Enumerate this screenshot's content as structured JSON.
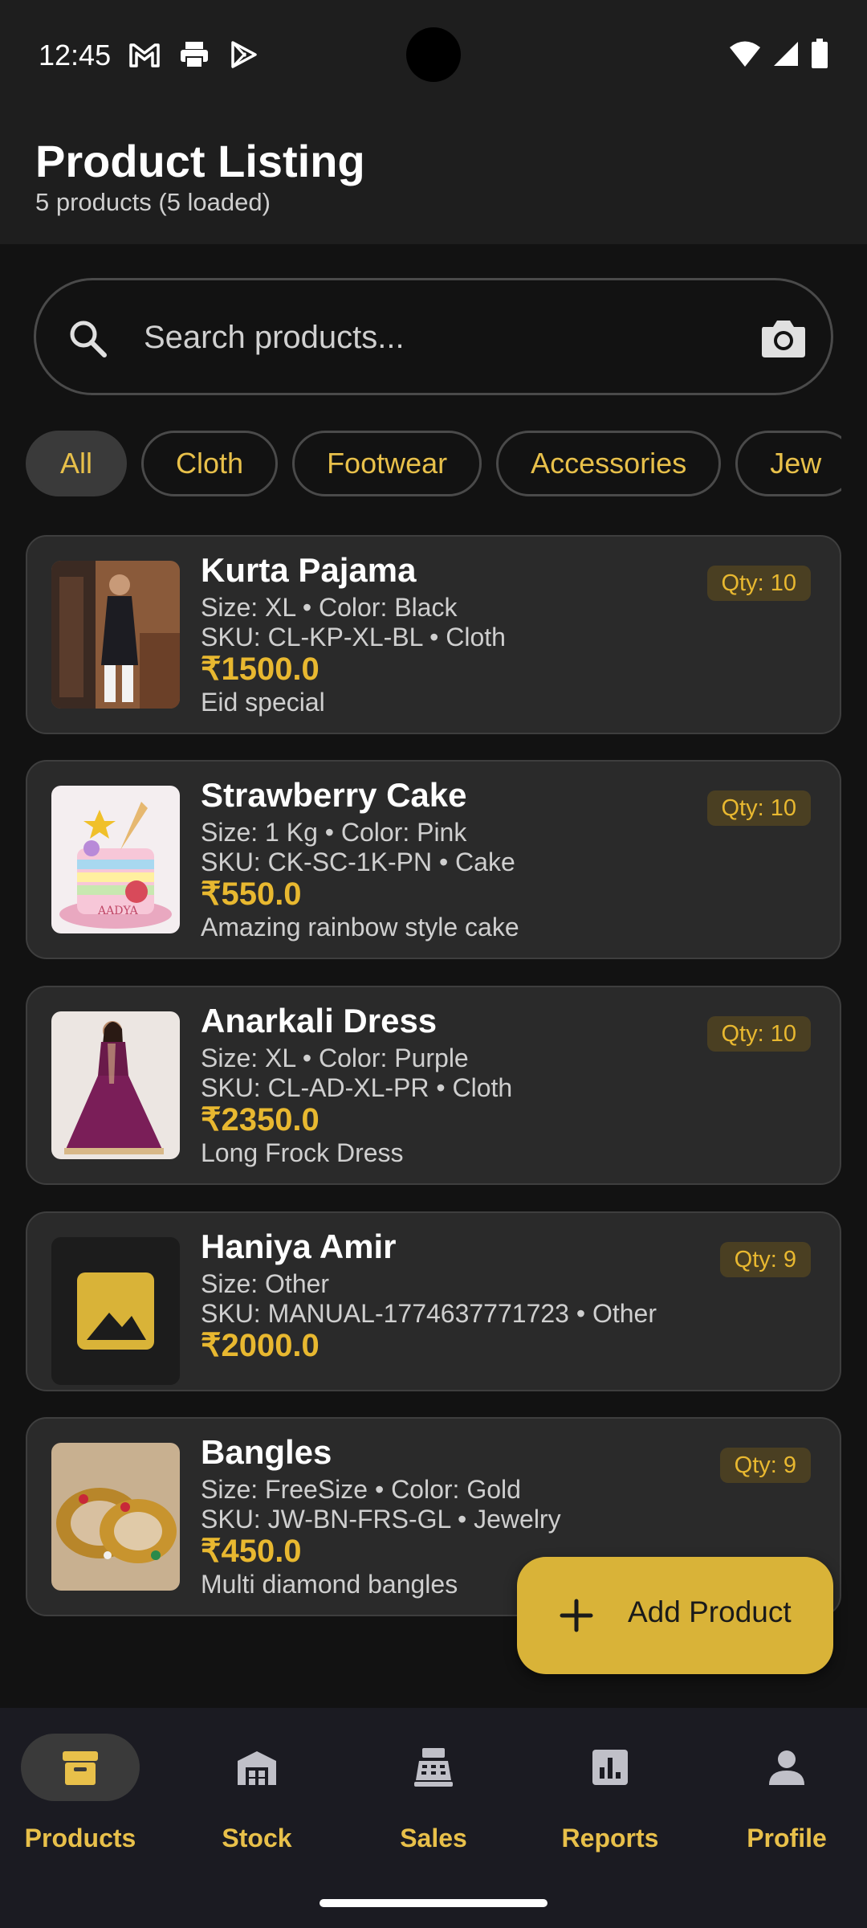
{
  "status_bar": {
    "time": "12:45",
    "left_icons": [
      "gmail-icon",
      "print-icon",
      "play-store-icon"
    ],
    "right_icons": [
      "wifi-icon",
      "signal-icon",
      "battery-icon"
    ]
  },
  "header": {
    "title": "Product Listing",
    "subtitle": "5 products (5 loaded)"
  },
  "search": {
    "placeholder": "Search products...",
    "value": ""
  },
  "categories": [
    {
      "label": "All",
      "selected": true
    },
    {
      "label": "Cloth",
      "selected": false
    },
    {
      "label": "Footwear",
      "selected": false
    },
    {
      "label": "Accessories",
      "selected": false
    },
    {
      "label": "Jew",
      "selected": false
    }
  ],
  "products": [
    {
      "name": "Kurta Pajama",
      "details": "Size: XL • Color: Black",
      "sku": "SKU: CL-KP-XL-BL • Cloth",
      "price": "₹1500.0",
      "description": "Eid special",
      "qty": "Qty: 10",
      "image": "kurta-photo"
    },
    {
      "name": "Strawberry Cake",
      "details": "Size: 1 Kg • Color: Pink",
      "sku": "SKU: CK-SC-1K-PN • Cake",
      "price": "₹550.0",
      "description": "Amazing rainbow style cake",
      "qty": "Qty: 10",
      "image": "cake-photo"
    },
    {
      "name": "Anarkali Dress",
      "details": "Size: XL • Color: Purple",
      "sku": "SKU: CL-AD-XL-PR • Cloth",
      "price": "₹2350.0",
      "description": "Long Frock Dress",
      "qty": "Qty: 10",
      "image": "dress-photo"
    },
    {
      "name": "Haniya Amir",
      "details": "Size: Other",
      "sku": "SKU: MANUAL-1774637771723 • Other",
      "price": "₹2000.0",
      "description": "",
      "qty": "Qty: 9",
      "image": "image-placeholder-icon"
    },
    {
      "name": "Bangles",
      "details": "Size: FreeSize • Color: Gold",
      "sku": "SKU: JW-BN-FRS-GL • Jewelry",
      "price": "₹450.0",
      "description": "Multi diamond bangles",
      "qty": "Qty: 9",
      "image": "bangles-photo"
    }
  ],
  "fab": {
    "label": "Add Product",
    "icon": "plus-icon"
  },
  "bottom_nav": [
    {
      "label": "Products",
      "icon": "archive-box-icon",
      "active": true
    },
    {
      "label": "Stock",
      "icon": "warehouse-icon",
      "active": false
    },
    {
      "label": "Sales",
      "icon": "cash-register-icon",
      "active": false
    },
    {
      "label": "Reports",
      "icon": "bar-chart-icon",
      "active": false
    },
    {
      "label": "Profile",
      "icon": "person-icon",
      "active": false
    }
  ],
  "colors": {
    "accent": "#e8c04a",
    "price": "#e8b830",
    "fab": "#d9b338",
    "card": "#2a2a2a",
    "background": "#121212"
  }
}
